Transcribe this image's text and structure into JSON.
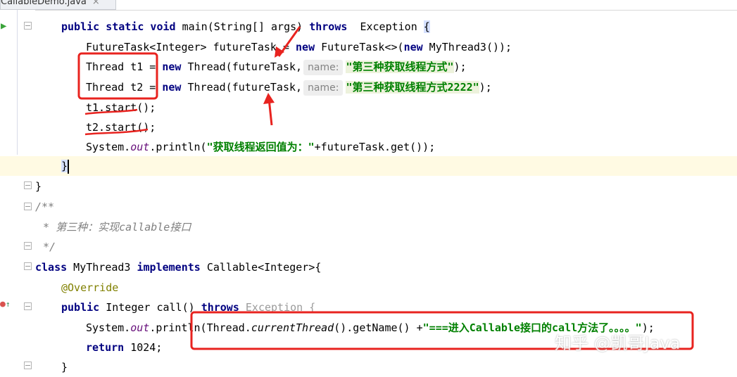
{
  "tab": {
    "file_name": "CallableDemo.java",
    "close_glyph": "×"
  },
  "gutter": {
    "run_icon": "run-arrow-icon",
    "override_icon": "override-marker-icon",
    "fold_icon": "fold-toggle-icon"
  },
  "colors": {
    "keyword": "#000080",
    "string": "#008000",
    "comment": "#808080",
    "annotation": "#808000",
    "highlight_box": "#e8231f",
    "current_line": "#fffae3"
  },
  "code": {
    "main_sig": {
      "pre": "public static void ",
      "name": "main(String[] args)",
      "throws": "throws",
      "exc": "Exception",
      "brace": "{"
    },
    "futuretask_line": {
      "type": "FutureTask<Integer> futureTask",
      "eq": " = ",
      "new": "new",
      "rest": " FutureTask<>(",
      "new2": "new",
      "rest2": " MyThread3());"
    },
    "t1_line": {
      "decl": "Thread t1",
      "eq": " = ",
      "new": "new",
      "call": " Thread(futureTask,",
      "hint": "name:",
      "str": "\"第三种获取线程方式\"",
      "end": ");"
    },
    "t2_line": {
      "decl": "Thread t2",
      "eq": " = ",
      "new": "new",
      "call": " Thread(futureTask,",
      "hint": "name:",
      "str": "\"第三种获取线程方式2222\"",
      "end": ");"
    },
    "t1_start": {
      "text": "t1.start();"
    },
    "t2_start": {
      "text": "t2.start();"
    },
    "println_line": {
      "pre": "System.",
      "out": "out",
      "mid": ".println(",
      "str": "\"获取线程返回值为：\"",
      "end": "+futureTask.get());"
    },
    "close_main": {
      "text": "}"
    },
    "close_class": {
      "text": "}"
    },
    "comment_open": {
      "text": "/**"
    },
    "comment_body": {
      "text": " * 第三种：实现callable接口"
    },
    "comment_close": {
      "text": " */"
    },
    "class_line": {
      "kw": "class",
      "name": " MyThread3 ",
      "impl": "implements",
      "rest": " Callable<Integer>{"
    },
    "override_line": {
      "text": "@Override"
    },
    "call_sig": {
      "kw": "public",
      "rest": " Integer call() ",
      "throws": "throws",
      "exc": " Exception {"
    },
    "sysout2": {
      "pre": "System.",
      "out": "out",
      "mid": ".println(Thread.",
      "method": "currentThread",
      "mid2": "().getName() +",
      "str": "\"===进入Callable接口的call方法了。。。。\"",
      "end": ");"
    },
    "return_line": {
      "kw": "return",
      "rest": " 1024;"
    },
    "close_call": {
      "text": "}"
    }
  },
  "watermark": {
    "text": "知乎 @凯哥Java"
  }
}
